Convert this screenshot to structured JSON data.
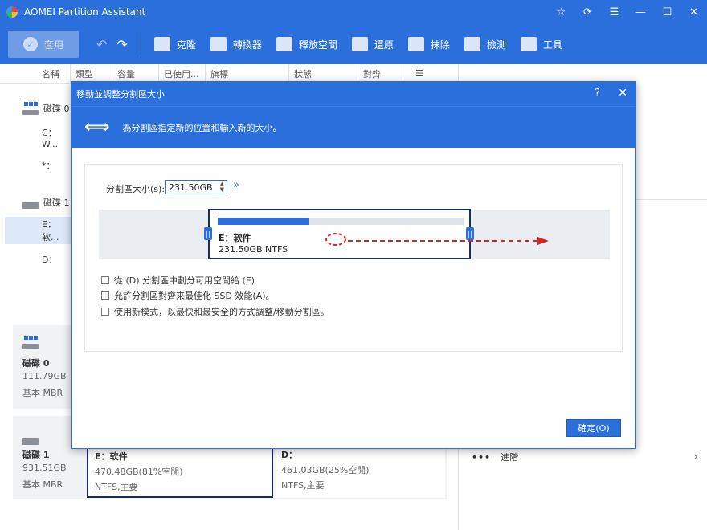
{
  "app": {
    "title": "AOMEI Partition Assistant"
  },
  "window_controls": {
    "star": "☆",
    "refresh": "⟳",
    "menu": "☰",
    "minimize": "—",
    "maximize": "☐",
    "close": "✕"
  },
  "toolbar": {
    "apply": "套用",
    "tools": [
      "克隆",
      "轉換器",
      "釋放空間",
      "還原",
      "抹除",
      "檢測",
      "工具"
    ]
  },
  "columns": [
    "名稱",
    "類型",
    "容量",
    "已使用...",
    "旗標",
    "狀態",
    "對齊"
  ],
  "disk_list": {
    "disk0": "磁碟 0",
    "c_drive": "C：W...",
    "star_drive": "*：",
    "disk1": "磁碟 1",
    "e_drive": "E：软...",
    "d_drive": "D："
  },
  "disk_cards": [
    {
      "name": "磁碟 0",
      "size": "111.79GB",
      "type": "基本 MBR"
    },
    {
      "name": "磁碟 1",
      "size": "931.51GB",
      "type": "基本 MBR"
    }
  ],
  "partitions": [
    {
      "name": "E：软件",
      "info": "470.48GB(81%空閒)",
      "fs": "NTFS,主要"
    },
    {
      "name": "D：",
      "info": "461.03GB(25%空閒)",
      "fs": "NTFS,主要"
    }
  ],
  "right_panel": {
    "advanced": "進階"
  },
  "dialog": {
    "title": "移動並調整分割區大小",
    "help": "?",
    "close": "✕",
    "banner": "為分割區指定新的位置和輸入新的大小。",
    "size_label": "分割區大小(s):",
    "size_value": "231.50GB",
    "partition_name": "E：软件",
    "partition_size": "231.50GB NTFS",
    "used_fraction": 0.37,
    "options": [
      "從 (D) 分割區中劃分可用空間給 (E)",
      "允許分割區對齊來最佳化 SSD 效能(A)。",
      "使用新模式，以最快和最安全的方式調整/移動分割區。"
    ],
    "ok": "確定(O)"
  },
  "colors": {
    "accent": "#2a6fdc",
    "partition_border": "#1b2c63",
    "arrow": "#d42424"
  }
}
